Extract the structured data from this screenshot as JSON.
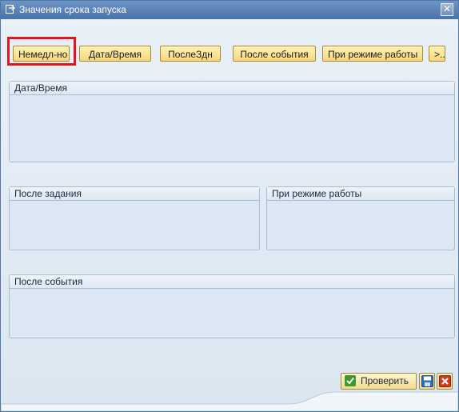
{
  "window": {
    "title": "Значения срока запуска"
  },
  "toolbar": {
    "buttons": [
      {
        "label": "Немедл-но"
      },
      {
        "label": "Дата/Время"
      },
      {
        "label": "ПослеЗдн"
      },
      {
        "label": "После события"
      },
      {
        "label": "При режиме работы"
      },
      {
        "label": ">.."
      }
    ]
  },
  "groups": {
    "datetime": {
      "title": "Дата/Время"
    },
    "after_job": {
      "title": "После задания"
    },
    "op_mode": {
      "title": "При режиме работы"
    },
    "after_event": {
      "title": "После события"
    }
  },
  "footer": {
    "check_label": "Проверить"
  },
  "colors": {
    "title_bar": "#4a73a8",
    "button_fill": "#f6d778",
    "highlight": "#e3151a",
    "panel": "#dbe7f2"
  }
}
